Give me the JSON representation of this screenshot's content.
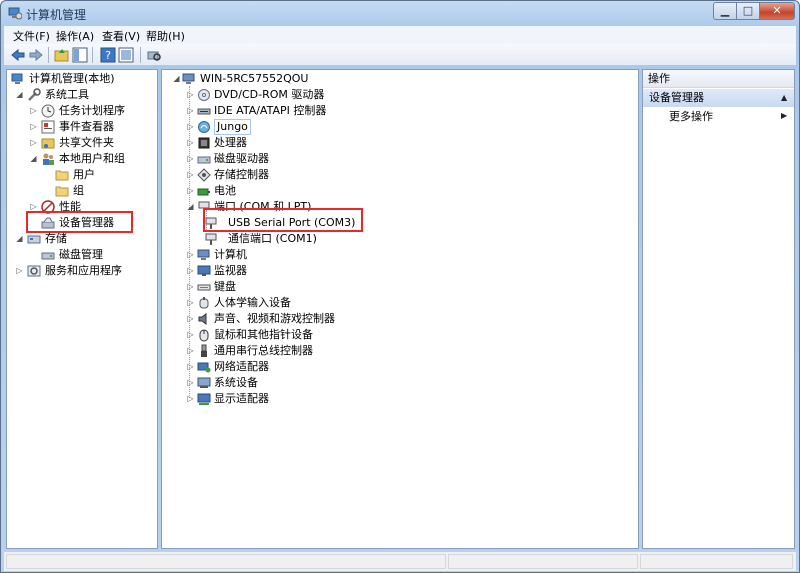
{
  "window": {
    "title": "计算机管理"
  },
  "menu": {
    "items": [
      "文件(F)",
      "操作(A)",
      "查看(V)",
      "帮助(H)"
    ]
  },
  "left_tree": {
    "root": "计算机管理(本地)",
    "system_tools": "系统工具",
    "task_scheduler": "任务计划程序",
    "event_viewer": "事件查看器",
    "shared_folders": "共享文件夹",
    "local_users_groups": "本地用户和组",
    "users": "用户",
    "groups": "组",
    "performance": "性能",
    "device_manager": "设备管理器",
    "storage": "存储",
    "disk_management": "磁盘管理",
    "services_apps": "服务和应用程序"
  },
  "device_tree": {
    "computer_name": "WIN-5RC57552QOU",
    "categories": {
      "dvd": "DVD/CD-ROM 驱动器",
      "ide": "IDE ATA/ATAPI 控制器",
      "jungo": "Jungo",
      "processors": "处理器",
      "disk_drives": "磁盘驱动器",
      "storage_controllers": "存储控制器",
      "battery": "电池",
      "ports": "端口 (COM 和 LPT)",
      "usb_serial": "USB Serial Port (COM3)",
      "com1": "通信端口 (COM1)",
      "computer": "计算机",
      "monitors": "监视器",
      "keyboards": "键盘",
      "hid": "人体学输入设备",
      "sound": "声音、视频和游戏控制器",
      "mice": "鼠标和其他指针设备",
      "usb_controllers": "通用串行总线控制器",
      "network": "网络适配器",
      "system_devices": "系统设备",
      "display": "显示适配器"
    }
  },
  "actions": {
    "header": "操作",
    "section": "设备管理器",
    "more": "更多操作"
  },
  "colors": {
    "highlight_box": "#e22c2c",
    "title_text": "#1e395b",
    "frame": "#b9d1ee"
  }
}
